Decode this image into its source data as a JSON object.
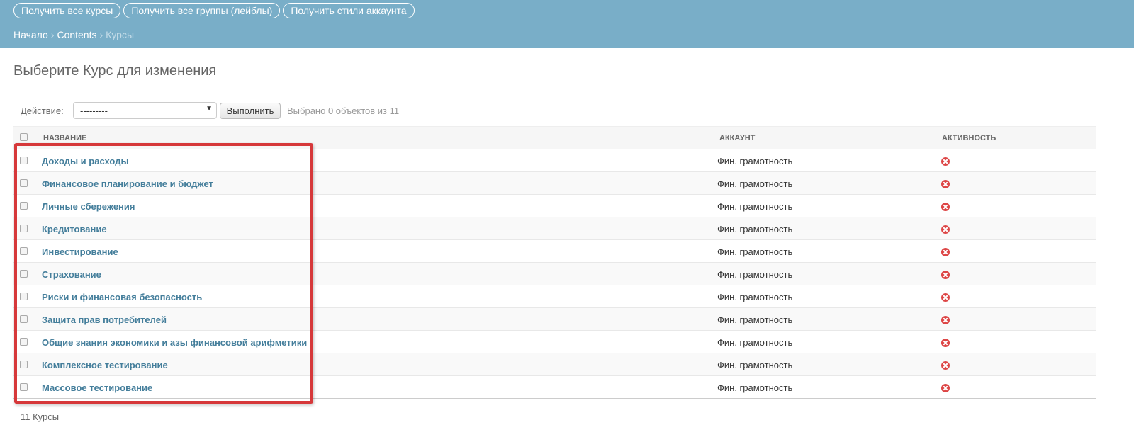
{
  "header": {
    "buttons": [
      {
        "label": "Получить все курсы"
      },
      {
        "label": "Получить все группы (лейблы)"
      },
      {
        "label": "Получить стили аккаунта"
      }
    ],
    "breadcrumbs": [
      "Начало",
      "Contents",
      "Курсы"
    ],
    "breadcrumb_separator": "›"
  },
  "page_title": "Выберите Курс для изменения",
  "actions": {
    "label": "Действие:",
    "selected_action": "---------",
    "run_label": "Выполнить",
    "counter": "Выбрано 0 объектов из 11"
  },
  "table": {
    "columns": [
      "Название",
      "Аккаунт",
      "Активность"
    ],
    "rows": [
      {
        "name": "Доходы и расходы",
        "account": "Фин. грамотность",
        "active": false
      },
      {
        "name": "Финансовое планирование и бюджет",
        "account": "Фин. грамотность",
        "active": false
      },
      {
        "name": "Личные сбережения",
        "account": "Фин. грамотность",
        "active": false
      },
      {
        "name": "Кредитование",
        "account": "Фин. грамотность",
        "active": false
      },
      {
        "name": "Инвестирование",
        "account": "Фин. грамотность",
        "active": false
      },
      {
        "name": "Страхование",
        "account": "Фин. грамотность",
        "active": false
      },
      {
        "name": "Риски и финансовая безопасность",
        "account": "Фин. грамотность",
        "active": false
      },
      {
        "name": "Защита прав потребителей",
        "account": "Фин. грамотность",
        "active": false
      },
      {
        "name": "Общие знания экономики и азы финансовой арифметики",
        "account": "Фин. грамотность",
        "active": false
      },
      {
        "name": "Комплексное тестирование",
        "account": "Фин. грамотность",
        "active": false
      },
      {
        "name": "Массовое тестирование",
        "account": "Фин. грамотность",
        "active": false
      }
    ]
  },
  "paginator": "11 Курсы",
  "icons": {
    "inactive": "x-circle-icon"
  },
  "colors": {
    "header_bg": "#79aec8",
    "link": "#447e9b",
    "inactive_icon": "#dd4646",
    "highlight_border": "#d6383a"
  }
}
